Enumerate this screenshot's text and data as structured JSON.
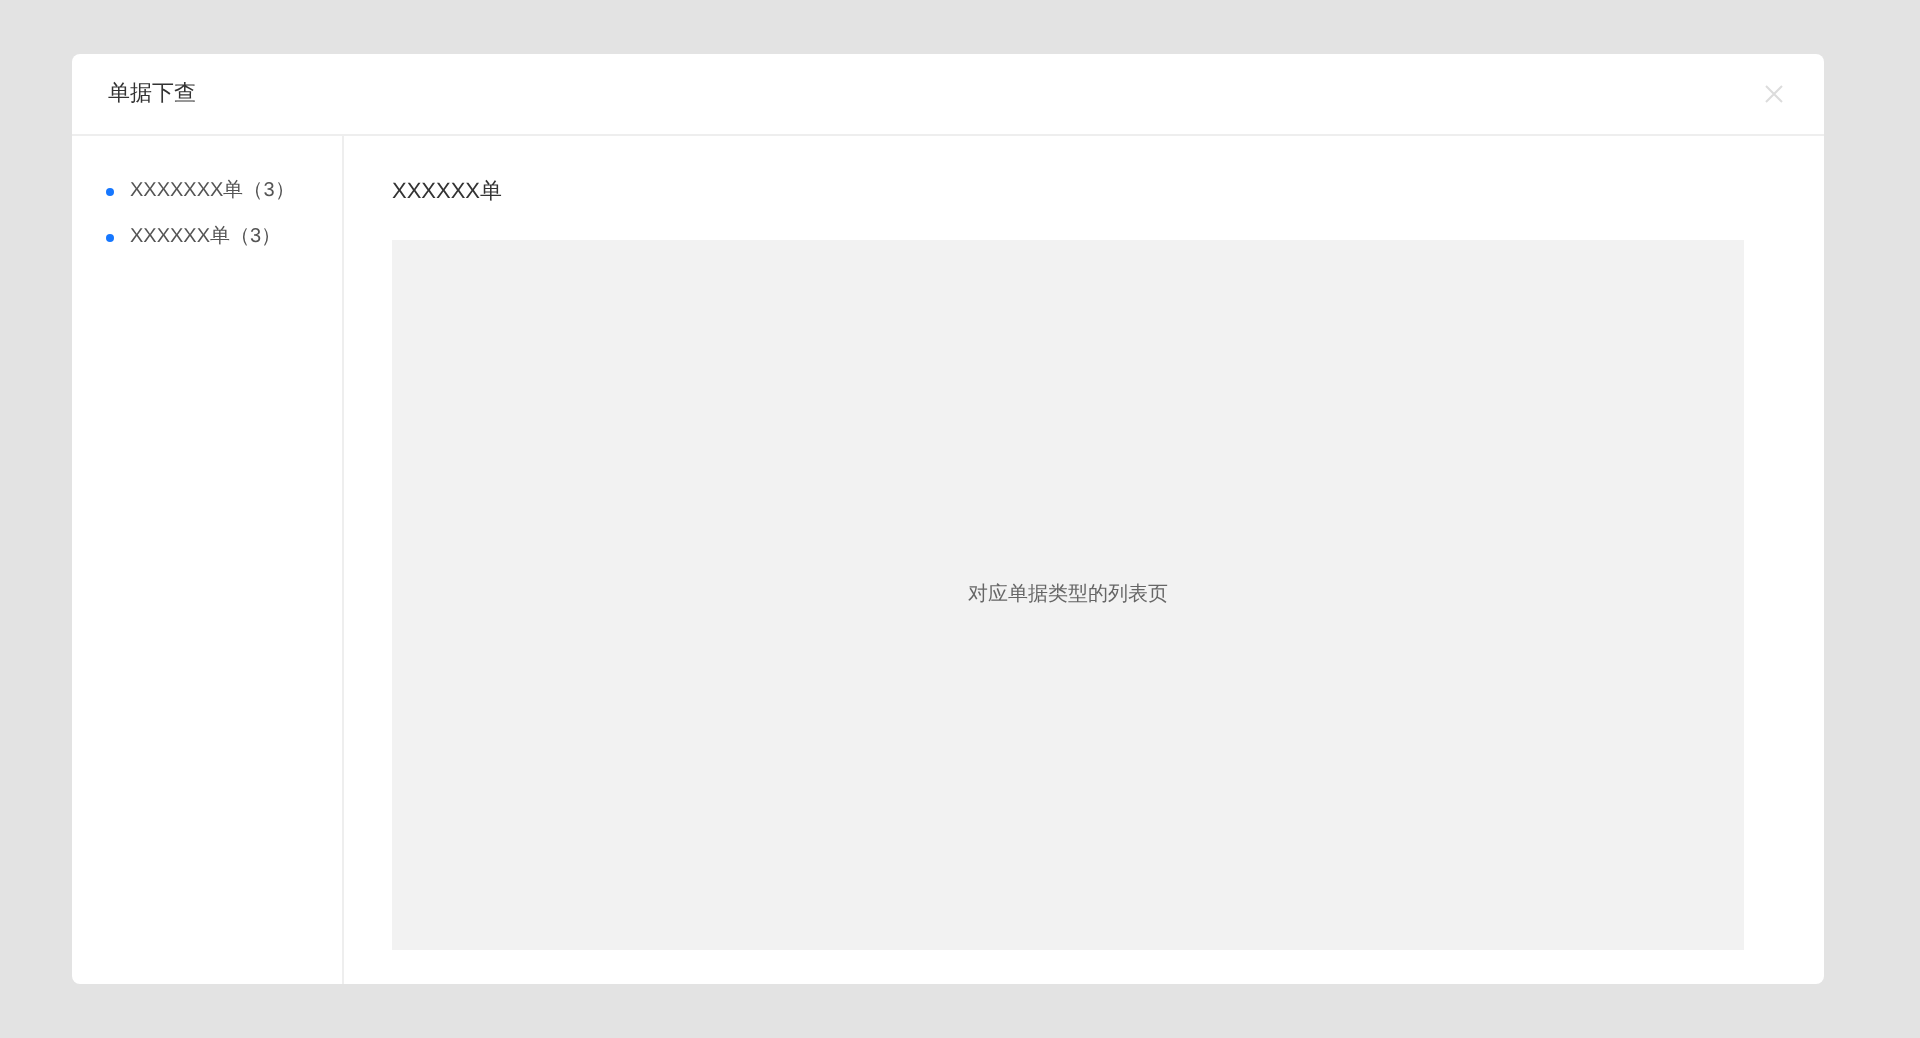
{
  "dialog": {
    "title": "单据下查"
  },
  "sidebar": {
    "items": [
      {
        "label": "XXXXXXX单（3）",
        "selected": false
      },
      {
        "label": "XXXXXX单（3）",
        "selected": false
      }
    ]
  },
  "content": {
    "title": "XXXXXX单",
    "placeholder_text": "对应单据类型的列表页"
  }
}
